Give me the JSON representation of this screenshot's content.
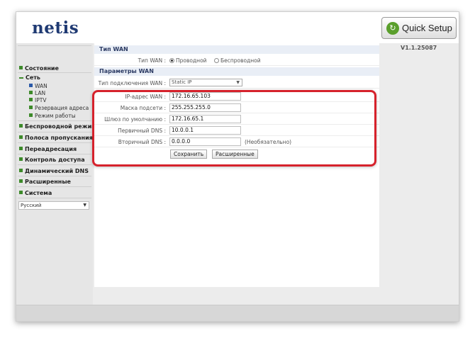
{
  "header": {
    "logo": "netis",
    "quick_setup": "Quick Setup",
    "version": "V1.1.25087"
  },
  "sidebar": {
    "items": [
      {
        "label": "Состояние"
      },
      {
        "label": "Сеть"
      },
      {
        "label": "Беспроводной режим"
      },
      {
        "label": "Полоса пропускания"
      },
      {
        "label": "Переадресация"
      },
      {
        "label": "Контроль доступа"
      },
      {
        "label": "Динамический DNS"
      },
      {
        "label": "Расширенные"
      },
      {
        "label": "Система"
      }
    ],
    "sub_items": [
      {
        "label": "WAN"
      },
      {
        "label": "LAN"
      },
      {
        "label": "IPTV"
      },
      {
        "label": "Резервация адреса"
      },
      {
        "label": "Режим работы"
      }
    ],
    "language": "Русский"
  },
  "wan_type": {
    "section_title": "Тип WAN",
    "label": "Тип WAN :",
    "options": [
      "Проводной",
      "Беспроводной"
    ],
    "selected": "Проводной"
  },
  "wan_params": {
    "section_title": "Параметры WAN",
    "connection_label": "Тип подключения WAN :",
    "connection_value": "Static IP",
    "ip_label": "IP-адрес WAN :",
    "ip_value": "172.16.65.103",
    "mask_label": "Маска подсети :",
    "mask_value": "255.255.255.0",
    "gateway_label": "Шлюз по умолчанию :",
    "gateway_value": "172.16.65.1",
    "dns1_label": "Первичный DNS :",
    "dns1_value": "10.0.0.1",
    "dns2_label": "Вторичный DNS :",
    "dns2_value": "0.0.0.0",
    "dns2_note": "(Необязательно)",
    "save_button": "Сохранить",
    "advanced_button": "Расширенные"
  },
  "colors": {
    "accent_green": "#3d8a2a",
    "logo_blue": "#1f3a73",
    "highlight_red": "#d6222c"
  }
}
